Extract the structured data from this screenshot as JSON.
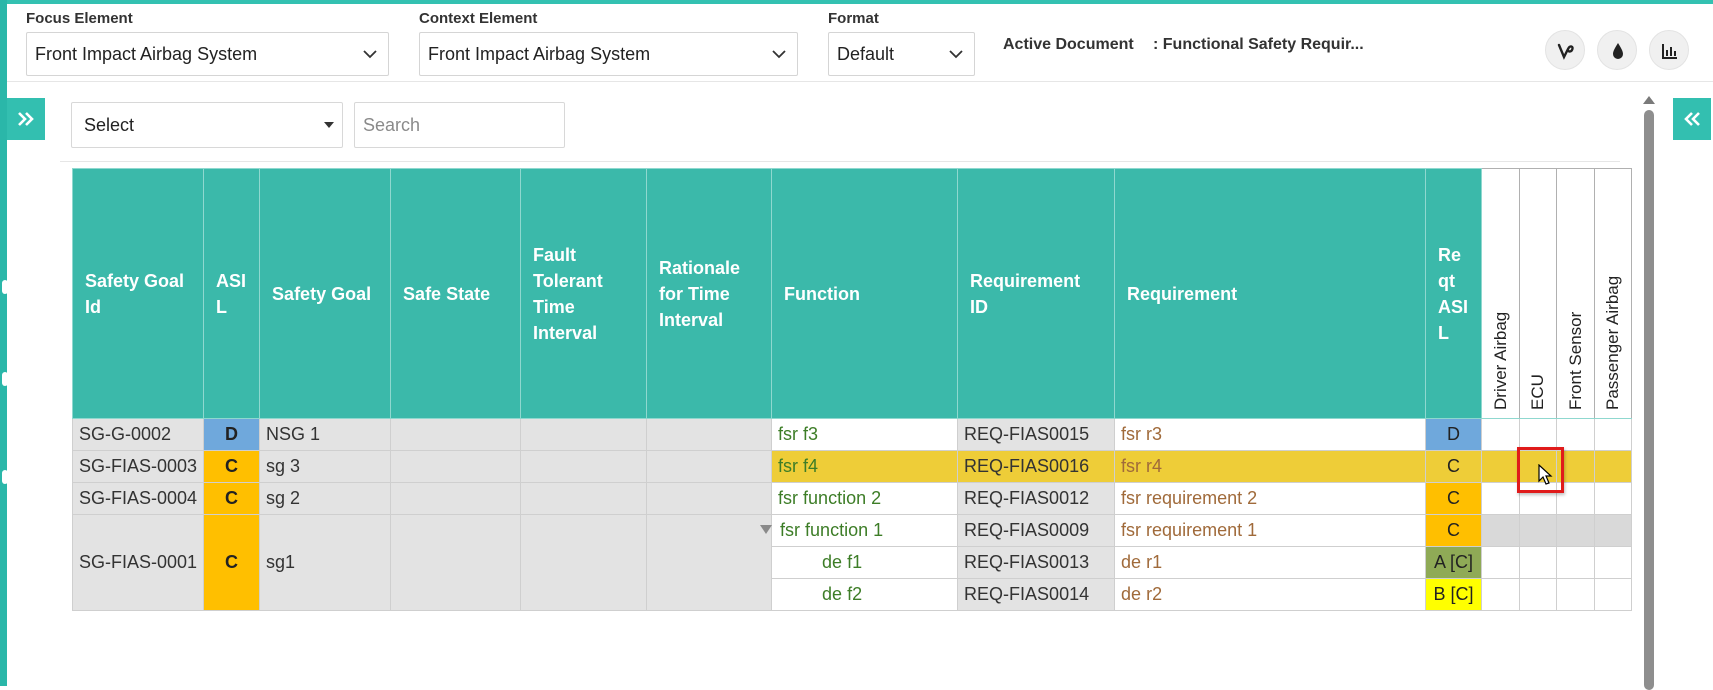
{
  "header": {
    "focus": {
      "label": "Focus Element",
      "value": "Front Impact Airbag System"
    },
    "context": {
      "label": "Context Element",
      "value": "Front Impact Airbag System"
    },
    "format": {
      "label": "Format",
      "value": "Default"
    },
    "active_document_label": "Active Document",
    "active_document_value": ": Functional Safety Requir...",
    "tools": [
      "vine-icon",
      "drop-icon",
      "bar-chart-icon"
    ]
  },
  "toolbar": {
    "select_value": "Select",
    "search_placeholder": "Search"
  },
  "colors": {
    "teal": "#3bb9aa",
    "asil_d": "#6fa8dc",
    "asil_c": "#ffbf00",
    "asil_a": "#8faa56",
    "asil_b": "#ffff00",
    "highlight_row": "#eecd38"
  },
  "table": {
    "headers": {
      "safety_goal_id": "Safety Goal Id",
      "asil": "ASIL",
      "safety_goal": "Safety Goal",
      "safe_state": "Safe State",
      "ftti": "Fault Tolerant Time Interval",
      "rationale": "Rationale for Time Interval",
      "function": "Function",
      "requirement_id": "Requirement ID",
      "requirement": "Requirement",
      "reqt_asil": "Reqt ASIL",
      "col_driver_airbag": "Driver Airbag",
      "col_ecu": "ECU",
      "col_front_sensor": "Front Sensor",
      "col_passenger_airbag": "Passenger Airbag"
    },
    "rows": [
      {
        "sg_id": "SG-G-0002",
        "asil": "D",
        "safety_goal": "NSG 1",
        "function": "fsr f3",
        "req_id": "REQ-FIAS0015",
        "requirement": "fsr r3",
        "reqt_asil": "D"
      },
      {
        "sg_id": "SG-FIAS-0003",
        "asil": "C",
        "safety_goal": "sg 3",
        "function": "fsr f4",
        "req_id": "REQ-FIAS0016",
        "requirement": "fsr r4",
        "reqt_asil": "C"
      },
      {
        "sg_id": "SG-FIAS-0004",
        "asil": "C",
        "safety_goal": "sg 2",
        "function": "fsr function 2",
        "req_id": "REQ-FIAS0012",
        "requirement": "fsr requirement 2",
        "reqt_asil": "C"
      },
      {
        "sg_id": "SG-FIAS-0001",
        "asil": "C",
        "safety_goal": "sg1",
        "function": "fsr function 1",
        "req_id": "REQ-FIAS0009",
        "requirement": "fsr requirement 1",
        "reqt_asil": "C"
      },
      {
        "function": "de f1",
        "req_id": "REQ-FIAS0013",
        "requirement": "de r1",
        "reqt_asil": "A [C]"
      },
      {
        "function": "de f2",
        "req_id": "REQ-FIAS0014",
        "requirement": "de r2",
        "reqt_asil": "B [C]"
      }
    ]
  }
}
